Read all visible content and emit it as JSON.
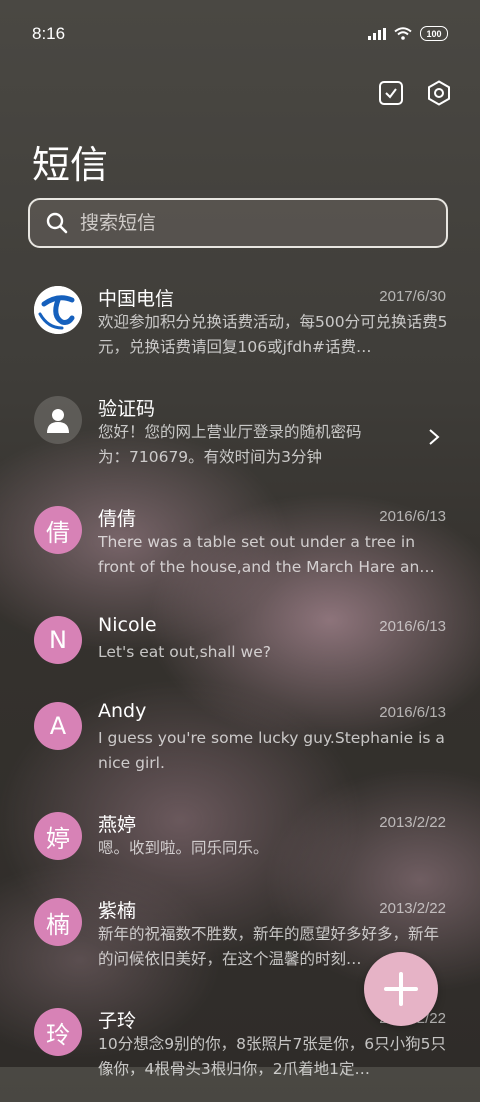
{
  "status": {
    "time": "8:16",
    "battery": "100",
    "icons": [
      "signal-icon",
      "wifi-icon",
      "battery-icon"
    ]
  },
  "toolbar": {
    "icons": [
      "checkbox-icon",
      "settings-icon"
    ]
  },
  "page": {
    "title": "短信"
  },
  "search": {
    "placeholder": "搜索短信"
  },
  "colors": {
    "avatar_pink": "#d782b6",
    "fab": "#e6b3c6",
    "telecom_blue": "#1560bd"
  },
  "messages": [
    {
      "name": "中国电信",
      "date": "2017/6/30",
      "preview": "欢迎参加积分兑换话费活动，每500分可兑换话费5元，兑换话费请回复106或jfdh#话费…",
      "avatar": "telecom-logo"
    },
    {
      "name": "验证码",
      "date": "",
      "preview": "您好！您的网上营业厅登录的随机密码为：710679。有效时间为3分钟",
      "avatar": "person-icon"
    },
    {
      "name": "倩倩",
      "date": "2016/6/13",
      "preview": "There was a table set out under a tree in front of the house,and the March Hare an…",
      "avatar_letter": "倩"
    },
    {
      "name": "Nicole",
      "date": "2016/6/13",
      "preview": "Let's eat out,shall we?",
      "avatar_letter": "N"
    },
    {
      "name": "Andy",
      "date": "2016/6/13",
      "preview": "I guess you're some lucky guy.Stephanie is a nice girl.",
      "avatar_letter": "A"
    },
    {
      "name": "燕婷",
      "date": "2013/2/22",
      "preview": "嗯。收到啦。同乐同乐。",
      "avatar_letter": "婷"
    },
    {
      "name": "紫楠",
      "date": "2013/2/22",
      "preview": "新年的祝福数不胜数，新年的愿望好多好多，新年的问候依旧美好，在这个温馨的时刻…",
      "avatar_letter": "楠"
    },
    {
      "name": "子玲",
      "date": "2013/2/22",
      "preview": "10分想念9别的你，8张照片7张是你，6只小狗5只像你，4根骨头3根归你，2爪着地1定…",
      "avatar_letter": "玲"
    }
  ]
}
